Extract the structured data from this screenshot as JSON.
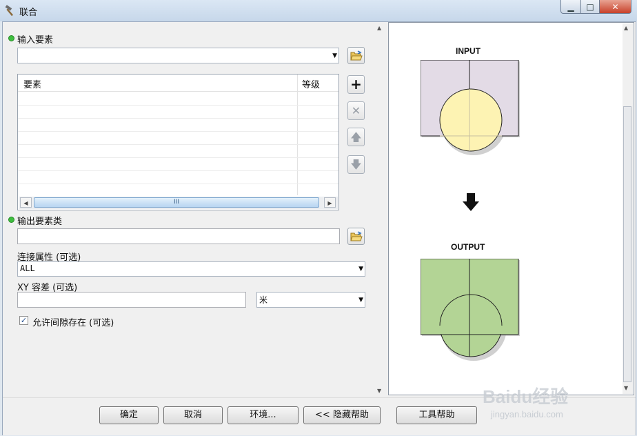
{
  "window": {
    "title": "联合"
  },
  "form": {
    "input_features_label": "输入要素",
    "table_headers": [
      "要素",
      "等级"
    ],
    "output_label": "输出要素类",
    "join_attr_label": "连接属性 (可选)",
    "join_attr_value": "ALL",
    "xy_tol_label": "XY 容差 (可选)",
    "xy_unit_value": "米",
    "gaps_label": "允许间隙存在 (可选)",
    "gaps_checked": "✓"
  },
  "buttons": {
    "ok": "确定",
    "cancel": "取消",
    "env": "环境...",
    "hide_help": "<< 隐藏帮助",
    "tool_help": "工具帮助"
  },
  "help": {
    "input_label": "INPUT",
    "output_label": "OUTPUT"
  },
  "watermark": {
    "brand": "Baidu经验",
    "url": "jingyan.baidu.com"
  },
  "colors": {
    "input_rect": "#e3dbe6",
    "input_circle": "#fdf3b3",
    "output_fill": "#b3d495",
    "required_dot": "#3fbf3f"
  }
}
